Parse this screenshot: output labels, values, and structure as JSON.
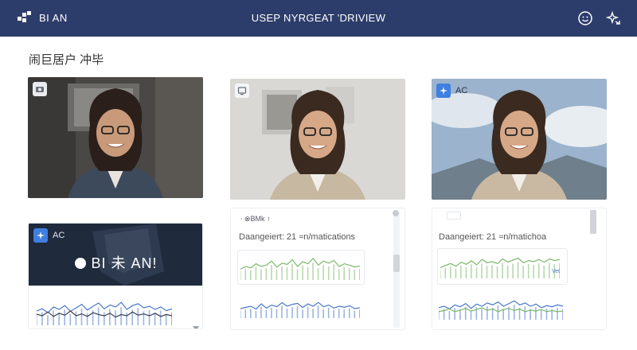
{
  "header": {
    "brand_name": "BI AN",
    "title": "USEP NYRGEAT 'DRIVIEW",
    "actions": [
      {
        "icon": "smiley-icon"
      },
      {
        "icon": "sparkle-share-icon"
      }
    ]
  },
  "section_title": "闹巨居户 冲毕",
  "tiles": [
    {
      "badge_icon": "camera-icon",
      "badge_label": ""
    },
    {
      "badge_icon": "screen-icon",
      "badge_label": ""
    },
    {
      "badge_icon": "sparkle-icon",
      "badge_label": "AC"
    }
  ],
  "panels": [
    {
      "badge_label": "AC",
      "banner_title": "BI 未 AN!",
      "chart_data": {
        "type": "line",
        "series": [
          {
            "values": [
              0.45,
              0.52,
              0.4,
              0.58,
              0.5,
              0.62,
              0.44,
              0.55,
              0.66,
              0.48,
              0.6,
              0.7,
              0.52,
              0.64,
              0.58,
              0.72,
              0.5,
              0.62,
              0.68,
              0.55,
              0.6,
              0.5,
              0.58,
              0.46,
              0.52
            ]
          },
          {
            "values": [
              0.35,
              0.3,
              0.42,
              0.28,
              0.38,
              0.32,
              0.45,
              0.3,
              0.36,
              0.28,
              0.4,
              0.34,
              0.3,
              0.38,
              0.26,
              0.34,
              0.3,
              0.42,
              0.32,
              0.36,
              0.3,
              0.38,
              0.28,
              0.34,
              0.3
            ]
          }
        ]
      }
    },
    {
      "header_text": "⸱ ⊗BMk ↑",
      "diag_text": "Daangeiert: 21 ≈n/matications",
      "chart_top": {
        "type": "line",
        "series": [
          {
            "values": [
              0.4,
              0.5,
              0.45,
              0.6,
              0.5,
              0.55,
              0.7,
              0.48,
              0.62,
              0.58,
              0.75,
              0.5,
              0.68,
              0.6,
              0.8,
              0.55,
              0.7,
              0.62,
              0.72,
              0.5,
              0.6,
              0.55,
              0.48,
              0.52
            ]
          }
        ]
      },
      "chart_bottom": {
        "type": "line",
        "series": [
          {
            "values": [
              0.4,
              0.45,
              0.5,
              0.38,
              0.6,
              0.42,
              0.55,
              0.48,
              0.65,
              0.5,
              0.58,
              0.62,
              0.45,
              0.6,
              0.5,
              0.66,
              0.48,
              0.55,
              0.42,
              0.5,
              0.46,
              0.52,
              0.4,
              0.44
            ]
          }
        ]
      }
    },
    {
      "diag_text": "Daangeiert: 21 ≈n/matichoa",
      "chart_top": {
        "type": "line",
        "series": [
          {
            "values": [
              0.4,
              0.48,
              0.55,
              0.45,
              0.6,
              0.52,
              0.65,
              0.5,
              0.7,
              0.58,
              0.62,
              0.55,
              0.72,
              0.6,
              0.68,
              0.75,
              0.58,
              0.66,
              0.62,
              0.7,
              0.6,
              0.72,
              0.66,
              0.7
            ]
          }
        ]
      },
      "chart_top_tag": "Vet",
      "chart_bottom": {
        "type": "line",
        "series": [
          {
            "values": [
              0.45,
              0.5,
              0.4,
              0.55,
              0.48,
              0.6,
              0.42,
              0.58,
              0.5,
              0.62,
              0.55,
              0.66,
              0.5,
              0.6,
              0.7,
              0.55,
              0.62,
              0.5,
              0.58,
              0.45,
              0.52,
              0.48,
              0.55,
              0.5
            ]
          },
          {
            "values": [
              0.3,
              0.34,
              0.4,
              0.3,
              0.36,
              0.42,
              0.32,
              0.38,
              0.44,
              0.35,
              0.4,
              0.3,
              0.38,
              0.42,
              0.34,
              0.4,
              0.3,
              0.36,
              0.32,
              0.38,
              0.3,
              0.34,
              0.3,
              0.32
            ]
          }
        ]
      }
    }
  ],
  "colors": {
    "header_bg": "#2d3d6b",
    "accent_blue": "#3f7fe0",
    "line_green": "#7cb86a",
    "line_blue": "#4a78c8",
    "line_dark": "#3a3f55"
  }
}
